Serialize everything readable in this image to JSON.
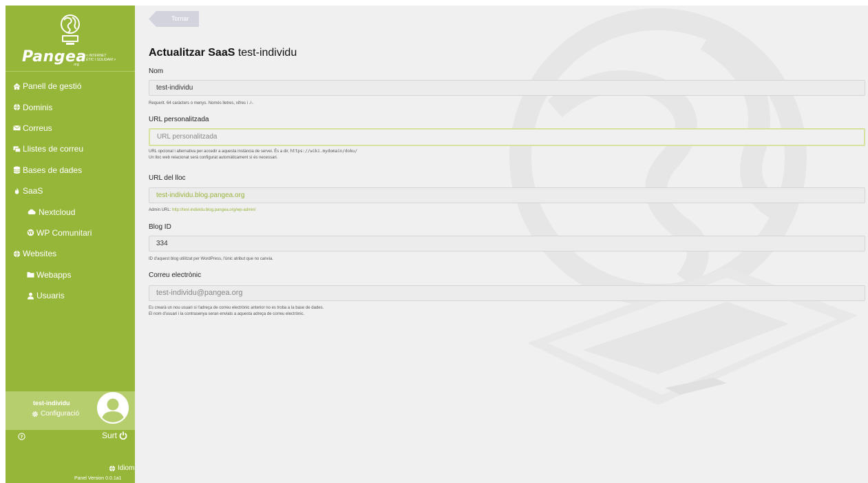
{
  "sidebar": {
    "brand": "Pangea",
    "brand_suffix": ".org",
    "tagline_line1": "< INTERNET",
    "tagline_line2": "ÈTIC I SOLIDARI >",
    "items": [
      {
        "label": "Panell de gestió",
        "icon": "home-icon"
      },
      {
        "label": "Dominis",
        "icon": "globe-icon"
      },
      {
        "label": "Correus",
        "icon": "envelope-icon"
      },
      {
        "label": "Llistes de correu",
        "icon": "mailing-list-icon"
      },
      {
        "label": "Bases de dades",
        "icon": "database-icon"
      },
      {
        "label": "SaaS",
        "icon": "fire-icon"
      },
      {
        "label": "Nextcloud",
        "icon": "cloud-icon"
      },
      {
        "label": "WP Comunitari",
        "icon": "wordpress-icon"
      },
      {
        "label": "Websites",
        "icon": "globe-icon"
      },
      {
        "label": "Webapps",
        "icon": "folder-icon"
      },
      {
        "label": "Usuaris",
        "icon": "user-icon"
      }
    ],
    "user": {
      "name": "test-individu",
      "settings_label": "Configuració"
    },
    "logout_label": "Surt",
    "language_label": "Idioma",
    "version": "Panel Version 0.0.1a1"
  },
  "main": {
    "back_label": "Tornar",
    "title_bold": "Actualitzar SaaS",
    "title_rest": " test-individu",
    "fields": {
      "name": {
        "label": "Nom",
        "value": "test-individu",
        "help": "Requerit. 64 caràcters o menys. Només lletres, xifres i ./-."
      },
      "custom_url": {
        "label": "URL personalitzada",
        "placeholder": "URL personalitzada",
        "help_prefix": "URL opcional i alternativa per accedir a aquesta instància de servei. És a dir, ",
        "help_code": "https://wiki.mydomain/doku/",
        "help_line2": "Un lloc web relacionat serà configurat automàticament si és necessari."
      },
      "site_url": {
        "label": "URL del lloc",
        "value": "test-individu.blog.pangea.org",
        "help_prefix": "Admin URL: ",
        "help_link": "http://test-individu.blog.pangea.org/wp-admin/"
      },
      "blog_id": {
        "label": "Blog ID",
        "value": "334",
        "help": "ID d'aquest blog utilitzat per WordPress, l'únic atribut que no canvia."
      },
      "email": {
        "label": "Correu electrònic",
        "value": "test-individu@pangea.org",
        "help_line1": "Es crearà un nou usuari si l'adreça de correu electrònic anterior no es troba a la base de dades.",
        "help_line2": "El nom d'usuari i la contrasenya seran enviats a aquesta adreça de correu electrònic."
      }
    }
  },
  "colors": {
    "sidebar": "#96b63a",
    "sidebar_user": "#b7ce6f",
    "link": "#97b43c",
    "background": "#f0f0f0"
  }
}
